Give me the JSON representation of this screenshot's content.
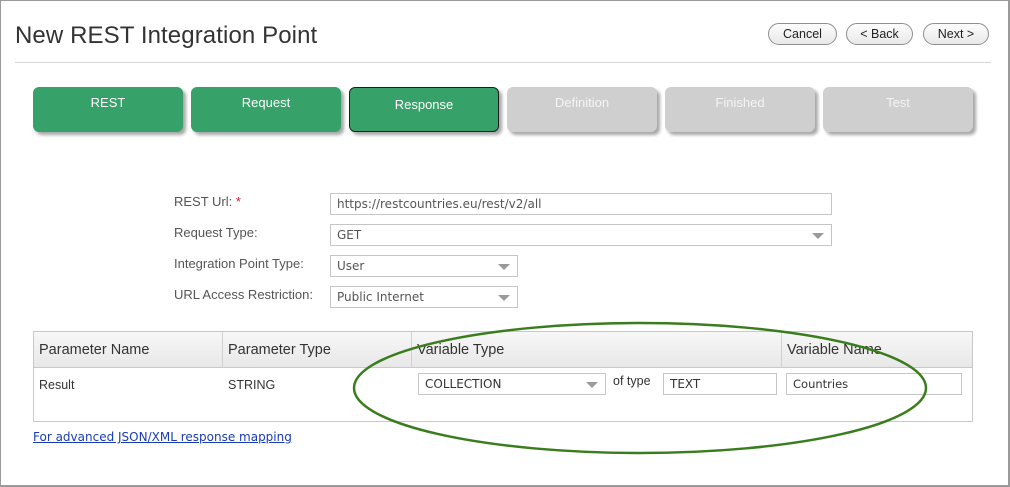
{
  "header": {
    "title": "New REST Integration Point",
    "cancel_label": "Cancel",
    "back_label": "< Back",
    "next_label": "Next >"
  },
  "steps": [
    {
      "label": "REST",
      "state": "done"
    },
    {
      "label": "Request",
      "state": "done"
    },
    {
      "label": "Response",
      "state": "active"
    },
    {
      "label": "Definition",
      "state": "todo"
    },
    {
      "label": "Finished",
      "state": "todo"
    },
    {
      "label": "Test",
      "state": "todo"
    }
  ],
  "form": {
    "rest_url_label": "REST Url:",
    "required_mark": "*",
    "rest_url_value": "https://restcountries.eu/rest/v2/all",
    "request_type_label": "Request Type:",
    "request_type_value": "GET",
    "integration_point_type_label": "Integration Point Type:",
    "integration_point_type_value": "User",
    "url_access_label": "URL Access Restriction:",
    "url_access_value": "Public Internet"
  },
  "grid": {
    "columns": [
      "Parameter Name",
      "Parameter Type",
      "Variable Type",
      "Variable Name"
    ],
    "row": {
      "parameter_name": "Result",
      "parameter_type": "STRING",
      "variable_type": "COLLECTION",
      "of_type_label": "of type",
      "of_type_value": "TEXT",
      "variable_name": "Countries"
    }
  },
  "links": {
    "advanced_mapping": "For advanced JSON/XML response mapping"
  },
  "colors": {
    "step_done": "#36a169",
    "step_todo": "#cfcfcf",
    "highlight_ellipse": "#3a7d1e",
    "link": "#1a3bb8",
    "required": "#dd1122"
  }
}
